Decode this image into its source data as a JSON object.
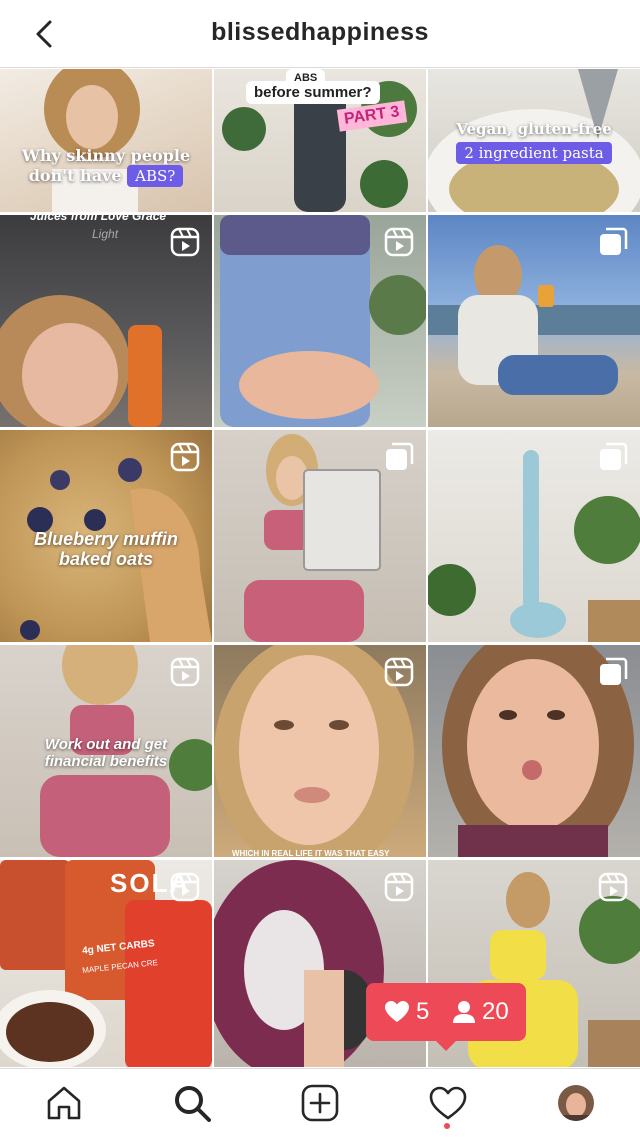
{
  "header": {
    "title": "blissedhappiness"
  },
  "tiles": [
    {
      "caption_line1": "Why skinny people",
      "caption_line2": "don't have",
      "pill": "ABS?"
    },
    {
      "top_pill": "ABS",
      "caption": "before summer?",
      "tag": "PART 3"
    },
    {
      "caption": "Vegan, gluten-free",
      "pill": "2 ingredient pasta"
    },
    {
      "caption": "Juices from Love Grace",
      "sub": "Light",
      "badge": "reel-icon"
    },
    {
      "badge": "reel-icon"
    },
    {
      "badge": "carousel-icon"
    },
    {
      "caption_line1": "Blueberry muffin",
      "caption_line2": "baked oats",
      "badge": "reel-icon"
    },
    {
      "badge": "carousel-icon"
    },
    {
      "badge": "carousel-icon"
    },
    {
      "caption_line1": "Work out and get",
      "caption_line2": "financial benefits",
      "badge": "reel-icon"
    },
    {
      "caption": "WHICH IN REAL LIFE IT WAS THAT EASY",
      "badge": "reel-icon"
    },
    {
      "badge": "carousel-icon"
    },
    {
      "package_text_1": "4g NET CARBS",
      "package_text_2": "MAPLE PECAN CRE",
      "package_text_3": "SOLA",
      "badge": "reel-icon"
    },
    {
      "badge": "reel-icon"
    },
    {
      "badge": "reel-icon"
    }
  ],
  "notification": {
    "likes": "5",
    "followers": "20"
  },
  "colors": {
    "accent": "#ed4956",
    "pill": "#6d5ce6",
    "text": "#262626"
  }
}
